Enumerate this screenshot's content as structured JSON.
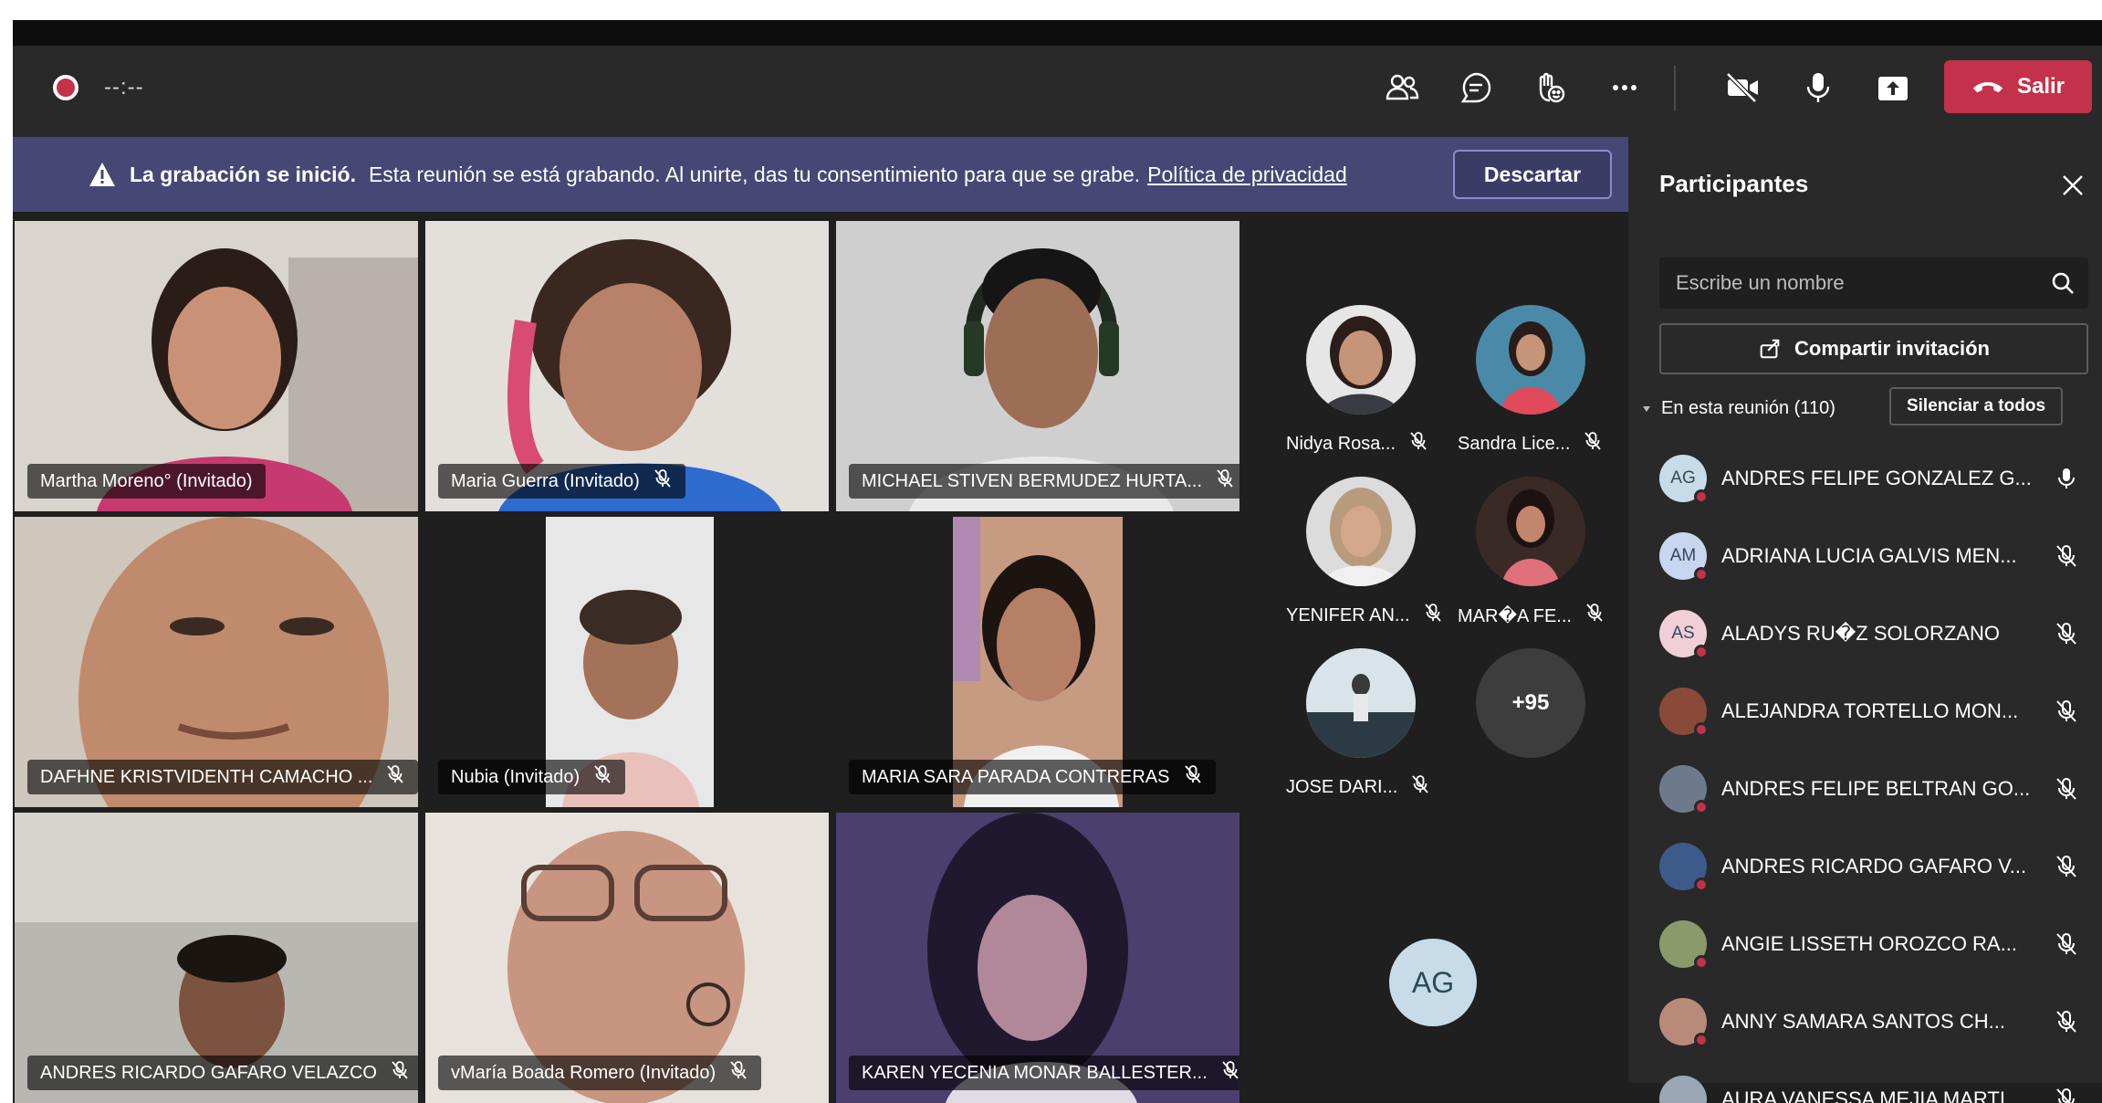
{
  "toolbar": {
    "timer": "--:--",
    "leave_label": "Salir"
  },
  "banner": {
    "title": "La grabación se inició.",
    "text": "Esta reunión se está grabando. Al unirte, das tu consentimiento para que se grabe.",
    "link": "Política de privacidad",
    "dismiss": "Descartar"
  },
  "tiles": [
    {
      "name": "Martha Moreno° (Invitado)",
      "muted": false
    },
    {
      "name": "Maria Guerra (Invitado)",
      "muted": true
    },
    {
      "name": "MICHAEL STIVEN BERMUDEZ HURTA...",
      "muted": true
    },
    {
      "name": "DAFHNE KRISTVIDENTH CAMACHO ...",
      "muted": true
    },
    {
      "name": "Nubia (Invitado)",
      "muted": true
    },
    {
      "name": "MARIA SARA PARADA CONTRERAS",
      "muted": true
    },
    {
      "name": "ANDRES RICARDO GAFARO VELAZCO",
      "muted": true
    },
    {
      "name": "vMaría Boada Romero (Invitado)",
      "muted": true
    },
    {
      "name": "KAREN YECENIA MONAR BALLESTER...",
      "muted": true
    }
  ],
  "avatars": [
    {
      "name": "Nidya Rosa..."
    },
    {
      "name": "Sandra Lice..."
    },
    {
      "name": "YENIFER AN..."
    },
    {
      "name": "MAR�A FE..."
    },
    {
      "name": "JOSE DARI..."
    }
  ],
  "more_count": "+95",
  "big_initials": "AG",
  "panel": {
    "title": "Participantes",
    "search_placeholder": "Escribe un nombre",
    "share": "Compartir invitación",
    "section": "En esta reunión (110)",
    "mute_all": "Silenciar a todos",
    "participants": [
      {
        "initials": "AG",
        "name": "ANDRES FELIPE GONZALEZ G...",
        "muted": false,
        "color": "#c7dce8"
      },
      {
        "initials": "AM",
        "name": "ADRIANA LUCIA GALVIS MEN...",
        "muted": true,
        "color": "#c9d6f0"
      },
      {
        "initials": "AS",
        "name": "ALADYS RU�Z SOLORZANO",
        "muted": true,
        "color": "#f1cfd8"
      },
      {
        "initials": "",
        "name": "ALEJANDRA TORTELLO MON...",
        "muted": true,
        "color": "#8a4a3a"
      },
      {
        "initials": "",
        "name": "ANDRES FELIPE BELTRAN GO...",
        "muted": true,
        "color": "#6d7a8c"
      },
      {
        "initials": "",
        "name": "ANDRES RICARDO GAFARO V...",
        "muted": true,
        "color": "#3e5a8a"
      },
      {
        "initials": "",
        "name": "ANGIE LISSETH OROZCO RA...",
        "muted": true,
        "color": "#8a9a6a"
      },
      {
        "initials": "",
        "name": "ANNY SAMARA SANTOS CH...",
        "muted": true,
        "color": "#b78a7a"
      },
      {
        "initials": "",
        "name": "AURA VANESSA MEJIA MARTI...",
        "muted": true,
        "color": "#9aa7b5"
      }
    ]
  },
  "colors": {
    "accent": "#7f85f5",
    "leave": "#c4314b",
    "banner": "#464775"
  }
}
